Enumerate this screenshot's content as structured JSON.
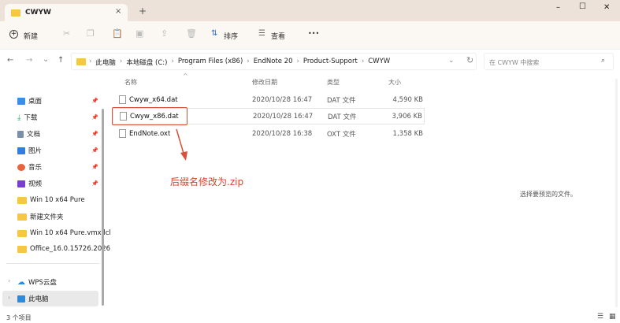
{
  "window": {
    "tab_title": "CWYW",
    "tab_close": "×",
    "new_tab": "+",
    "minimize": "–",
    "maximize": "☐",
    "close": "✕"
  },
  "toolbar": {
    "new_label": "新建",
    "sort_label": "排序",
    "view_label": "查看",
    "more": "•••"
  },
  "address": {
    "back": "←",
    "forward": "→",
    "recent": "⌄",
    "up": "↑",
    "crumbs": [
      "此电脑",
      "本地磁盘 (C:)",
      "Program Files (x86)",
      "EndNote 20",
      "Product-Support",
      "CWYW"
    ],
    "refresh": "↻",
    "search_placeholder": "在 CWYW 中搜索"
  },
  "sidebar": {
    "quick": [
      {
        "label": "桌面",
        "icon": "desktop-icon",
        "color": "#3a8ee6"
      },
      {
        "label": "下载",
        "icon": "download-icon",
        "color": "#2ea96a"
      },
      {
        "label": "文档",
        "icon": "document-icon",
        "color": "#7a8fa8"
      },
      {
        "label": "图片",
        "icon": "picture-icon",
        "color": "#2f7fe0"
      },
      {
        "label": "音乐",
        "icon": "music-icon",
        "color": "#e8643c"
      },
      {
        "label": "视频",
        "icon": "video-icon",
        "color": "#7b3fd0"
      }
    ],
    "folders": [
      "Win 10 x64 Pure",
      "新建文件夹",
      "Win 10 x64 Pure.vmx.lcl",
      "Office_16.0.15726.2026"
    ],
    "wps": "WPS云盘",
    "pc": "此电脑"
  },
  "columns": {
    "name": "名称",
    "date": "修改日期",
    "type": "类型",
    "size": "大小"
  },
  "files": [
    {
      "name": "Cwyw_x64.dat",
      "date": "2020/10/28 16:47",
      "type": "DAT 文件",
      "size": "4,590 KB"
    },
    {
      "name": "Cwyw_x86.dat",
      "date": "2020/10/28 16:47",
      "type": "DAT 文件",
      "size": "3,906 KB"
    },
    {
      "name": "EndNote.oxt",
      "date": "2020/10/28 16:38",
      "type": "OXT 文件",
      "size": "1,358 KB"
    }
  ],
  "annotation": {
    "text": "后缀名修改为.zip",
    "color": "#e0402a"
  },
  "preview": "选择要预览的文件。",
  "status": "3 个项目"
}
